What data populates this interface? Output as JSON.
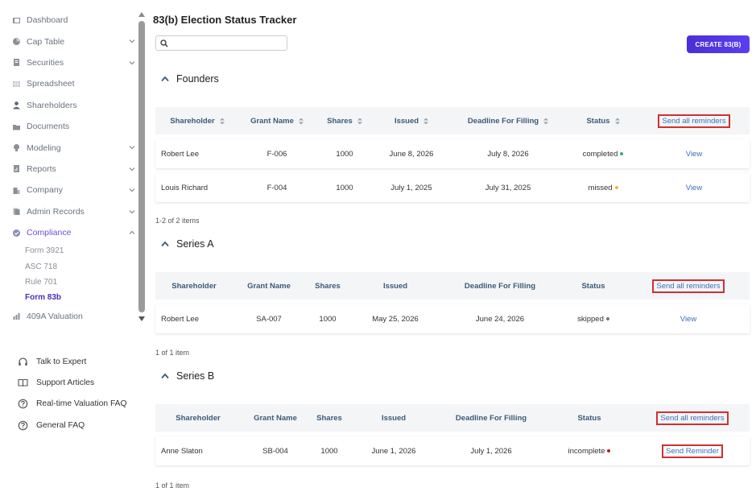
{
  "sidebar": {
    "items": [
      {
        "label": "Dashboard",
        "icon": "dashboard-icon",
        "has_chevron": false
      },
      {
        "label": "Cap Table",
        "icon": "pie-chart-icon",
        "has_chevron": true
      },
      {
        "label": "Securities",
        "icon": "document-icon",
        "has_chevron": true
      },
      {
        "label": "Spreadsheet",
        "icon": "spreadsheet-icon",
        "has_chevron": false
      },
      {
        "label": "Shareholders",
        "icon": "person-icon",
        "has_chevron": false
      },
      {
        "label": "Documents",
        "icon": "folder-icon",
        "has_chevron": false
      },
      {
        "label": "Modeling",
        "icon": "lightbulb-icon",
        "has_chevron": true
      },
      {
        "label": "Reports",
        "icon": "report-icon",
        "has_chevron": true
      },
      {
        "label": "Company",
        "icon": "building-icon",
        "has_chevron": true
      },
      {
        "label": "Admin Records",
        "icon": "records-icon",
        "has_chevron": true
      },
      {
        "label": "Compliance",
        "icon": "shield-check-icon",
        "has_chevron": true,
        "expanded": true
      }
    ],
    "compliance_sub": [
      "Form 3921",
      "ASC 718",
      "Rule 701",
      "Form 83b"
    ],
    "active_sub": "Form 83b",
    "after_items": [
      {
        "label": "409A Valuation",
        "icon": "valuation-icon"
      }
    ],
    "support": [
      {
        "label": "Talk to Expert",
        "icon": "headset-icon"
      },
      {
        "label": "Support Articles",
        "icon": "book-icon"
      },
      {
        "label": "Real-time Valuation FAQ",
        "icon": "question-icon"
      },
      {
        "label": "General FAQ",
        "icon": "question-icon"
      }
    ]
  },
  "page": {
    "title": "83(b) Election Status Tracker",
    "search_value": "",
    "create_button": "CREATE 83(B)"
  },
  "columns": [
    "Shareholder",
    "Grant Name",
    "Shares",
    "Issued",
    "Deadline For Filling",
    "Status"
  ],
  "send_all_label": "Send all reminders",
  "sections": [
    {
      "name": "Founders",
      "sortable": true,
      "rows": [
        {
          "shareholder": "Robert Lee",
          "grant": "F-006",
          "shares": "1000",
          "issued": "June 8, 2026",
          "deadline": "July 8, 2026",
          "status": "completed",
          "status_color": "#3aa57a",
          "action": "View"
        },
        {
          "shareholder": "Louis Richard",
          "grant": "F-004",
          "shares": "1000",
          "issued": "July 1, 2025",
          "deadline": "July 31, 2025",
          "status": "missed",
          "status_color": "#f2b632",
          "action": "View"
        }
      ],
      "count": "1-2 of 2 items"
    },
    {
      "name": "Series A",
      "sortable": false,
      "rows": [
        {
          "shareholder": "Robert Lee",
          "grant": "SA-007",
          "shares": "1000",
          "issued": "May 25, 2026",
          "deadline": "June 24, 2026",
          "status": "skipped",
          "status_color": "#777777",
          "action": "View"
        }
      ],
      "count": "1 of 1 item"
    },
    {
      "name": "Series B",
      "sortable": false,
      "rows": [
        {
          "shareholder": "Anne Slaton",
          "grant": "SB-004",
          "shares": "1000",
          "issued": "June 1, 2026",
          "deadline": "July 1, 2026",
          "status": "incomplete",
          "status_color": "#b02020",
          "action": "Send Reminder"
        }
      ],
      "count": "1 of 1 item"
    }
  ],
  "colors": {
    "accent": "#4c2fb5",
    "button": "#5134e3",
    "header_text": "#3b5a78",
    "highlight_border": "#d32f2f"
  }
}
